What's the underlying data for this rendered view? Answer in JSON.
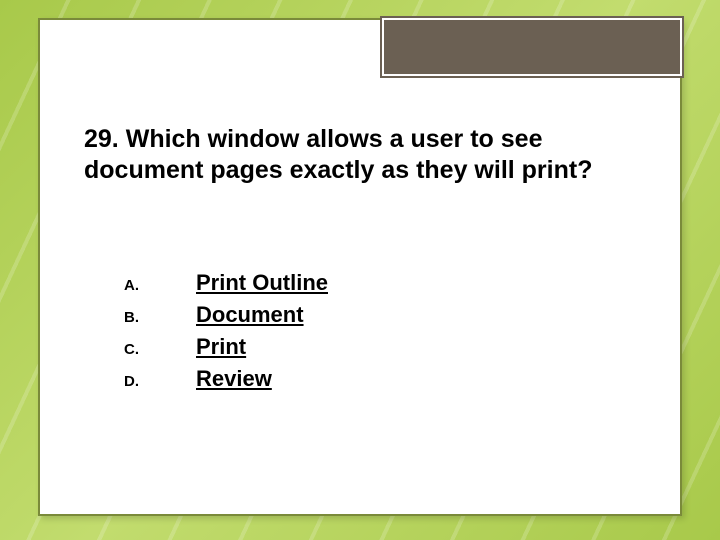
{
  "question": {
    "number": "29.",
    "text": "Which window allows a user to see document pages exactly as they will print?"
  },
  "options": [
    {
      "letter": "A.",
      "text": "Print Outline"
    },
    {
      "letter": "B.",
      "text": "Document"
    },
    {
      "letter": "C.",
      "text": "Print"
    },
    {
      "letter": "D.",
      "text": "Review"
    }
  ]
}
